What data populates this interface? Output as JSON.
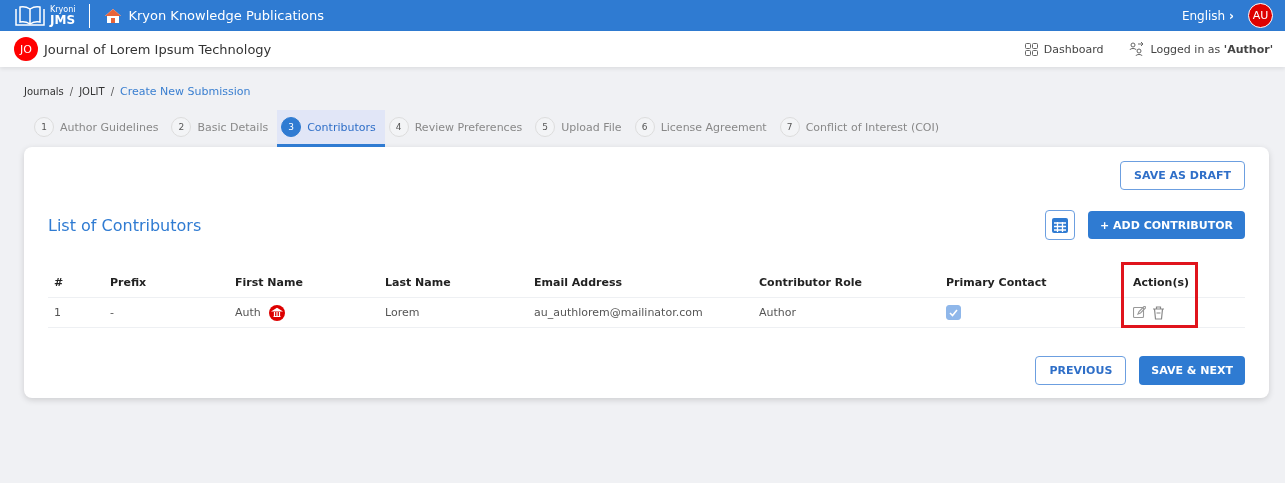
{
  "topbar": {
    "logo_small": "Kryoni",
    "logo_big": "JMS",
    "publisher": "Kryon Knowledge Publications",
    "language": "English",
    "language_caret": "›",
    "user_initials": "AU"
  },
  "journal_bar": {
    "initials": "JO",
    "title": "Journal of Lorem Ipsum Technology",
    "dashboard": "Dashboard",
    "logged_in": "Logged in as **'Author'**"
  },
  "breadcrumb": [
    {
      "label": "Journals",
      "current": false
    },
    {
      "label": "JOLIT",
      "current": false
    },
    {
      "label": "Create New Submission",
      "current": true
    }
  ],
  "breadcrumb_separator": "/",
  "steps": [
    {
      "number": "1",
      "label": "Author Guidelines",
      "selected": false
    },
    {
      "number": "2",
      "label": "Basic Details",
      "selected": false
    },
    {
      "number": "3",
      "label": "Contributors",
      "selected": true
    },
    {
      "number": "4",
      "label": "Review Preferences",
      "selected": false
    },
    {
      "number": "5",
      "label": "Upload File",
      "selected": false
    },
    {
      "number": "6",
      "label": "License Agreement",
      "selected": false
    },
    {
      "number": "7",
      "label": "Conflict of Interest (COI)",
      "selected": false
    }
  ],
  "save_draft": "SAVE AS DRAFT",
  "section_title": "List of Contributors",
  "add_button": "+ ADD CONTRIBUTOR",
  "table": {
    "columns": [
      "#",
      "Prefix",
      "First Name",
      "Last Name",
      "Email Address",
      "Contributor Role",
      "Primary Contact",
      "Action(s)"
    ],
    "rows": [
      {
        "index": "1",
        "prefix": "-",
        "first_name": "Auth",
        "institution_badge": true,
        "last_name": "Lorem",
        "email": "au_authlorem@mailinator.com",
        "role": "Author",
        "primary_contact": true
      }
    ]
  },
  "highlight_actions": true,
  "previous_button": "PREVIOUS",
  "next_button": "SAVE & NEXT"
}
